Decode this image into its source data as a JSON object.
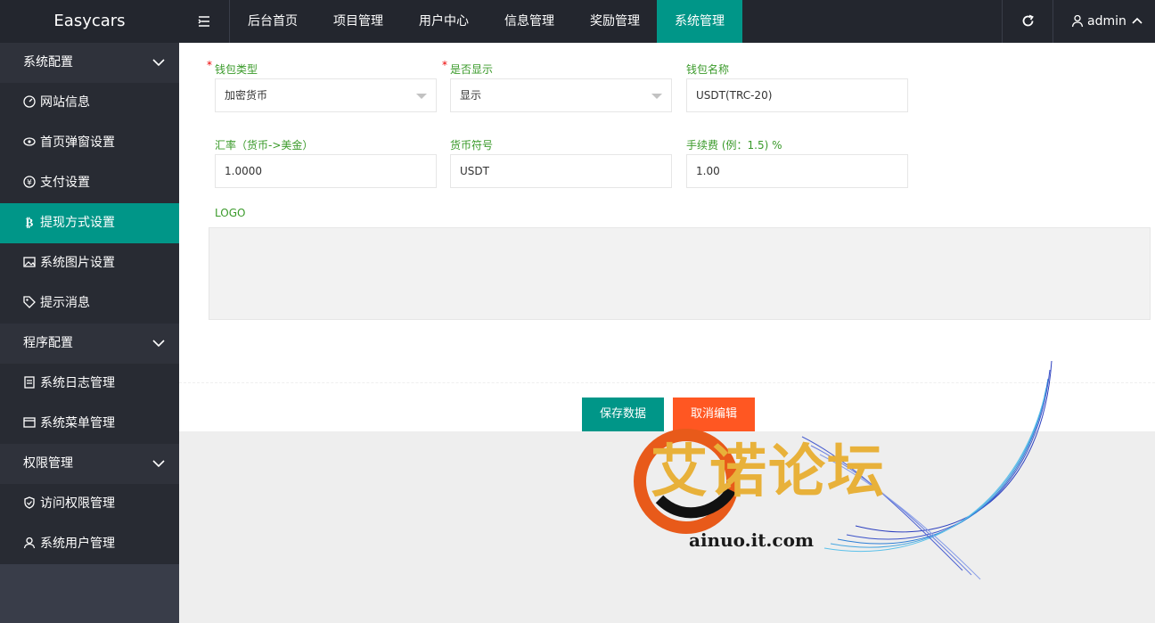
{
  "app": {
    "title": "Easycars"
  },
  "topnav": {
    "tabs": [
      {
        "label": "后台首页"
      },
      {
        "label": "项目管理"
      },
      {
        "label": "用户中心"
      },
      {
        "label": "信息管理"
      },
      {
        "label": "奖励管理"
      },
      {
        "label": "系统管理",
        "active": true
      }
    ],
    "user": "admin"
  },
  "sidebar": {
    "groups": [
      {
        "label": "系统配置",
        "items": [
          {
            "label": "网站信息",
            "icon": "dashboard-icon"
          },
          {
            "label": "首页弹窗设置",
            "icon": "eye-icon"
          },
          {
            "label": "支付设置",
            "icon": "yen-icon"
          },
          {
            "label": "提现方式设置",
            "icon": "bitcoin-icon",
            "active": true
          },
          {
            "label": "系统图片设置",
            "icon": "image-icon"
          },
          {
            "label": "提示消息",
            "icon": "tag-icon"
          }
        ]
      },
      {
        "label": "程序配置",
        "items": [
          {
            "label": "系统日志管理",
            "icon": "log-icon"
          },
          {
            "label": "系统菜单管理",
            "icon": "menu-icon"
          }
        ]
      },
      {
        "label": "权限管理",
        "items": [
          {
            "label": "访问权限管理",
            "icon": "shield-icon"
          },
          {
            "label": "系统用户管理",
            "icon": "user-icon"
          }
        ]
      }
    ]
  },
  "form": {
    "wallet_type": {
      "label": "钱包类型",
      "value": "加密货币"
    },
    "display": {
      "label": "是否显示",
      "value": "显示"
    },
    "wallet_name": {
      "label": "钱包名称",
      "value": "USDT(TRC-20)"
    },
    "rate": {
      "label": "汇率（货币->美金）",
      "value": "1.0000"
    },
    "symbol": {
      "label": "货币符号",
      "value": "USDT"
    },
    "fee": {
      "label": "手续费 (例：1.5) %",
      "value": "1.00"
    },
    "logo": {
      "label": "LOGO"
    }
  },
  "buttons": {
    "save": "保存数据",
    "cancel": "取消编辑"
  },
  "watermark": {
    "text": "艾诺论坛",
    "url": "ainuo.it.com"
  },
  "colors": {
    "accent": "#009688",
    "cancel": "#ff5722",
    "sidebar_bg": "#393d49",
    "label_green": "#3a9a2a"
  }
}
